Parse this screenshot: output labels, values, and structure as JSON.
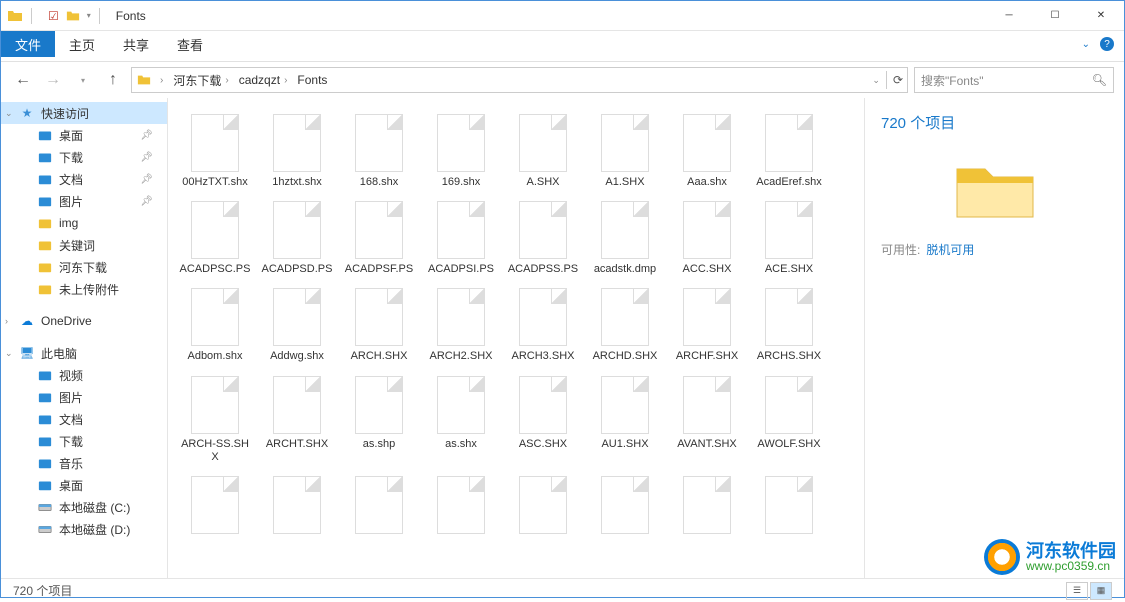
{
  "window": {
    "title": "Fonts"
  },
  "ribbon": {
    "file": "文件",
    "tabs": [
      "主页",
      "共享",
      "查看"
    ]
  },
  "nav": {
    "breadcrumbs": [
      "河东下载",
      "cadzqzt",
      "Fonts"
    ],
    "search_placeholder": "搜索\"Fonts\""
  },
  "sidebar": {
    "quick_access": "快速访问",
    "quick_items": [
      {
        "label": "桌面",
        "pinned": true,
        "color": "#2b8cd6"
      },
      {
        "label": "下载",
        "pinned": true,
        "color": "#2b8cd6"
      },
      {
        "label": "文档",
        "pinned": true,
        "color": "#2b8cd6"
      },
      {
        "label": "图片",
        "pinned": true,
        "color": "#2b8cd6"
      },
      {
        "label": "img",
        "pinned": false,
        "color": "#f0c237"
      },
      {
        "label": "关键词",
        "pinned": false,
        "color": "#f0c237"
      },
      {
        "label": "河东下载",
        "pinned": false,
        "color": "#f0c237"
      },
      {
        "label": "未上传附件",
        "pinned": false,
        "color": "#f0c237"
      }
    ],
    "onedrive": "OneDrive",
    "this_pc": "此电脑",
    "pc_items": [
      {
        "label": "视频",
        "color": "#2b8cd6"
      },
      {
        "label": "图片",
        "color": "#2b8cd6"
      },
      {
        "label": "文档",
        "color": "#2b8cd6"
      },
      {
        "label": "下载",
        "color": "#2b8cd6"
      },
      {
        "label": "音乐",
        "color": "#2b8cd6"
      },
      {
        "label": "桌面",
        "color": "#2b8cd6"
      },
      {
        "label": "本地磁盘 (C:)",
        "color": "#888"
      },
      {
        "label": "本地磁盘 (D:)",
        "color": "#888"
      }
    ]
  },
  "files": [
    "00HzTXT.shx",
    "1hztxt.shx",
    "168.shx",
    "169.shx",
    "A.SHX",
    "A1.SHX",
    "Aaa.shx",
    "AcadEref.shx",
    "ACADPSC.PS",
    "ACADPSD.PS",
    "ACADPSF.PS",
    "ACADPSI.PS",
    "ACADPSS.PS",
    "acadstk.dmp",
    "ACC.SHX",
    "ACE.SHX",
    "Adbom.shx",
    "Addwg.shx",
    "ARCH.SHX",
    "ARCH2.SHX",
    "ARCH3.SHX",
    "ARCHD.SHX",
    "ARCHF.SHX",
    "ARCHS.SHX",
    "ARCH-SS.SHX",
    "ARCHT.SHX",
    "as.shp",
    "as.shx",
    "ASC.SHX",
    "AU1.SHX",
    "AVANT.SHX",
    "AWOLF.SHX"
  ],
  "details": {
    "count": "720 个项目",
    "availability_label": "可用性:",
    "availability_value": "脱机可用"
  },
  "status": {
    "text": "720 个项目"
  },
  "watermark": {
    "cn": "河东软件园",
    "url": "www.pc0359.cn"
  }
}
